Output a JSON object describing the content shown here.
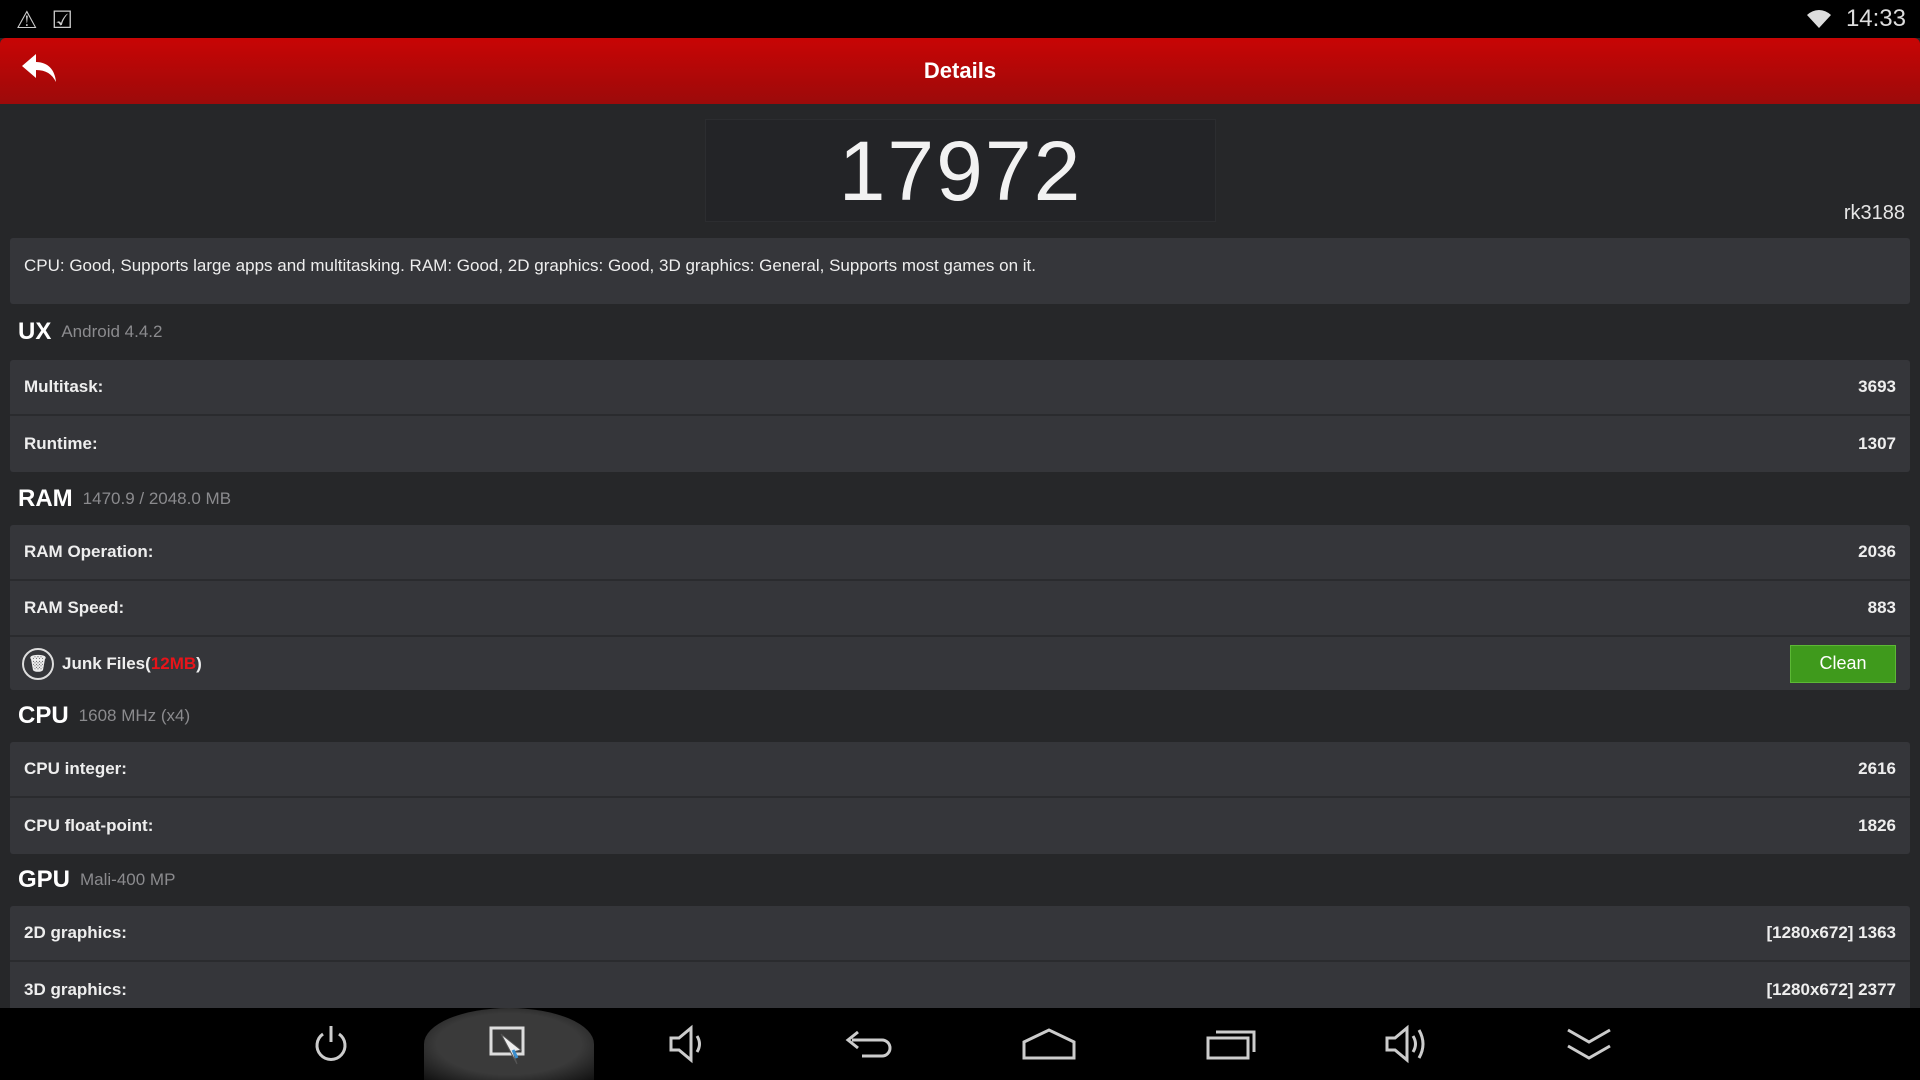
{
  "status_bar": {
    "time": "14:33",
    "icons": [
      "warning-icon",
      "shopping-bag-check-icon",
      "wifi-icon"
    ]
  },
  "header": {
    "title": "Details"
  },
  "score": {
    "value": "17972",
    "device": "rk3188"
  },
  "description": "CPU: Good, Supports large apps and multitasking. RAM: Good, 2D graphics: Good, 3D graphics: General, Supports most games on it.",
  "sections": {
    "ux": {
      "name": "UX",
      "sub": "Android 4.4.2",
      "rows": [
        {
          "label": "Multitask:",
          "value": "3693"
        },
        {
          "label": "Runtime:",
          "value": "1307"
        }
      ]
    },
    "ram": {
      "name": "RAM",
      "sub": "1470.9 / 2048.0 MB",
      "rows": [
        {
          "label": "RAM Operation:",
          "value": "2036"
        },
        {
          "label": "RAM Speed:",
          "value": "883"
        }
      ],
      "junk": {
        "label": "Junk Files(",
        "size": "12MB",
        "close": ")",
        "button": "Clean"
      }
    },
    "cpu": {
      "name": "CPU",
      "sub": "1608 MHz (x4)",
      "rows": [
        {
          "label": "CPU integer:",
          "value": "2616"
        },
        {
          "label": "CPU float-point:",
          "value": "1826"
        }
      ]
    },
    "gpu": {
      "name": "GPU",
      "sub": "Mali-400 MP",
      "rows": [
        {
          "label": "2D graphics:",
          "value": "[1280x672] 1363"
        },
        {
          "label": "3D graphics:",
          "value": "[1280x672] 2377"
        }
      ]
    }
  },
  "colors": {
    "header": "#c00707",
    "clean": "#3f9a1c",
    "junk_size": "#e8141a"
  },
  "nav_bar": [
    "power-icon",
    "screenshot-icon",
    "volume-down-icon",
    "back-icon",
    "home-icon",
    "recents-icon",
    "volume-up-icon",
    "collapse-icon"
  ]
}
